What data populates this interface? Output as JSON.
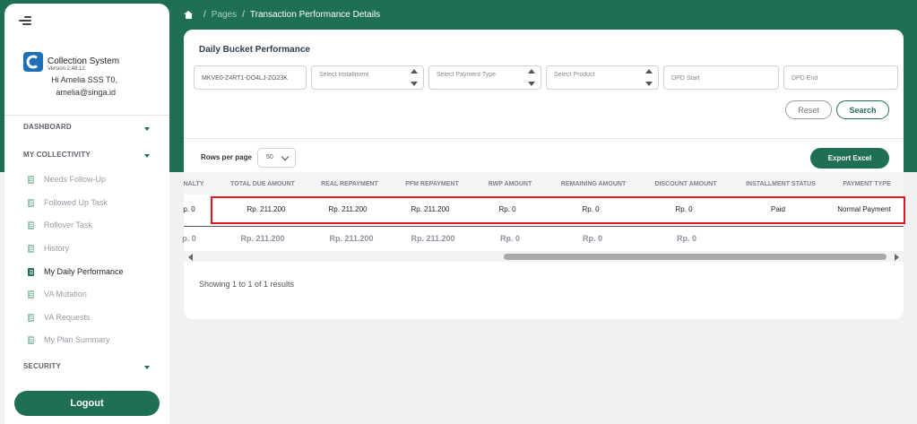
{
  "sidebar": {
    "brand_name": "Collection System",
    "version": "Version 2.48.12",
    "user_name": "Hi Amelia SSS T0,",
    "user_email": "amelia@singa.id",
    "sections": {
      "dashboard": "DASHBOARD",
      "my_collectivity": "MY COLLECTIVITY",
      "security": "SECURITY"
    },
    "menu": [
      {
        "label": "Needs Follow-Up",
        "active": false
      },
      {
        "label": "Followed Up Task",
        "active": false
      },
      {
        "label": "Rollover Task",
        "active": false
      },
      {
        "label": "History",
        "active": false
      },
      {
        "label": "My Daily Performance",
        "active": true
      },
      {
        "label": "VA Mutation",
        "active": false
      },
      {
        "label": "VA Requests",
        "active": false
      },
      {
        "label": "My Plan Summary",
        "active": false
      }
    ],
    "logout_label": "Logout"
  },
  "breadcrumb": {
    "home_icon": "home-icon",
    "pages": "Pages",
    "current": "Transaction Performance Details"
  },
  "filters": {
    "title": "Daily Bucket Performance",
    "loan_id": "MKVE0-Z4RT1-DO4LJ-ZG23K",
    "installment_placeholder": "Select Installment",
    "payment_type_placeholder": "Select Payment Type",
    "product_placeholder": "Select Product",
    "dpd_start_placeholder": "DPD Start",
    "dpd_end_placeholder": "DPD End",
    "reset_label": "Reset",
    "search_label": "Search"
  },
  "table": {
    "rows_per_page_label": "Rows per page",
    "rows_per_page_value": "50",
    "export_label": "Export Excel",
    "columns": [
      "NALTY",
      "TOTAL DUE AMOUNT",
      "REAL REPAYMENT",
      "PFM REPAYMENT",
      "RWP AMOUNT",
      "REMAINING AMOUNT",
      "DISCOUNT AMOUNT",
      "INSTALLMENT STATUS",
      "PAYMENT TYPE"
    ],
    "rows": [
      [
        "p. 0",
        "Rp. 211.200",
        "Rp. 211.200",
        "Rp. 211.200",
        "Rp. 0",
        "Rp. 0",
        "Rp. 0",
        "Paid",
        "Normal Payment"
      ]
    ],
    "footer": [
      "p. 0",
      "Rp. 211.200",
      "Rp. 211.200",
      "Rp. 211.200",
      "Rp. 0",
      "Rp. 0",
      "Rp. 0"
    ],
    "showing": "Showing 1 to 1 of 1 results"
  },
  "colors": {
    "brand_green": "#1f6f54",
    "highlight_red": "#e0151d"
  }
}
